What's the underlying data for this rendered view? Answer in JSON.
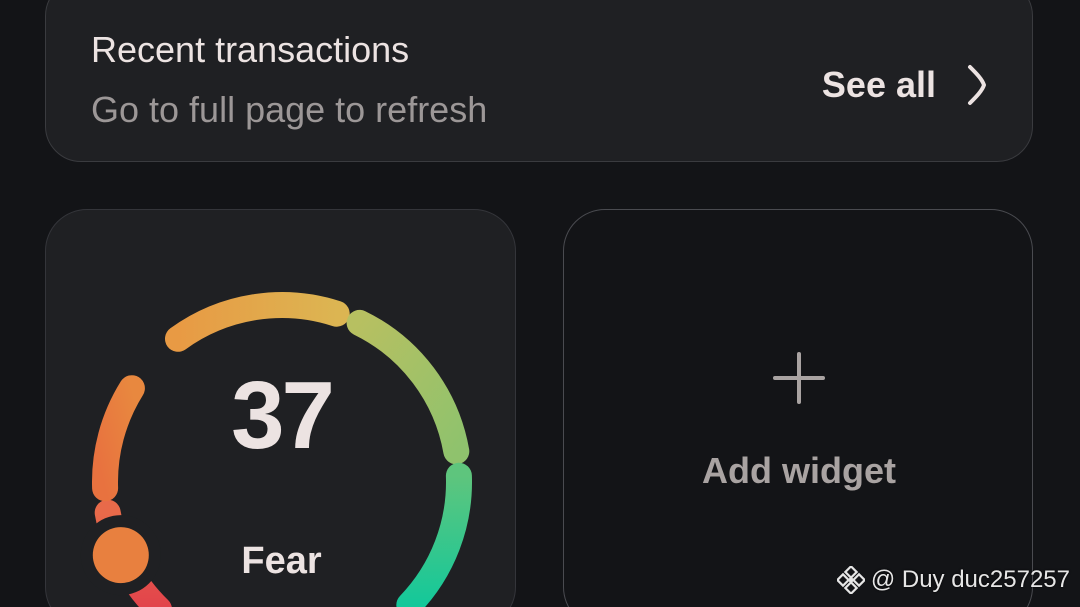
{
  "recent_transactions": {
    "title": "Recent transactions",
    "subtitle": "Go to full page to refresh",
    "see_all_label": "See all",
    "chevron_icon": "chevron-right-icon"
  },
  "fear_greed": {
    "value": "37",
    "label": "Fear",
    "level_fraction": 0.08,
    "colors": {
      "red": "#e2434b",
      "orange": "#e8803f",
      "yellow": "#e8b24a",
      "green": "#a7c36c",
      "teal": "#14c89a",
      "indicator": "#e8803f"
    }
  },
  "add_widget": {
    "label": "Add widget",
    "icon": "plus-icon"
  },
  "watermark": {
    "text": "@ Duy duc257257",
    "logo_icon": "binance-logo-icon"
  }
}
